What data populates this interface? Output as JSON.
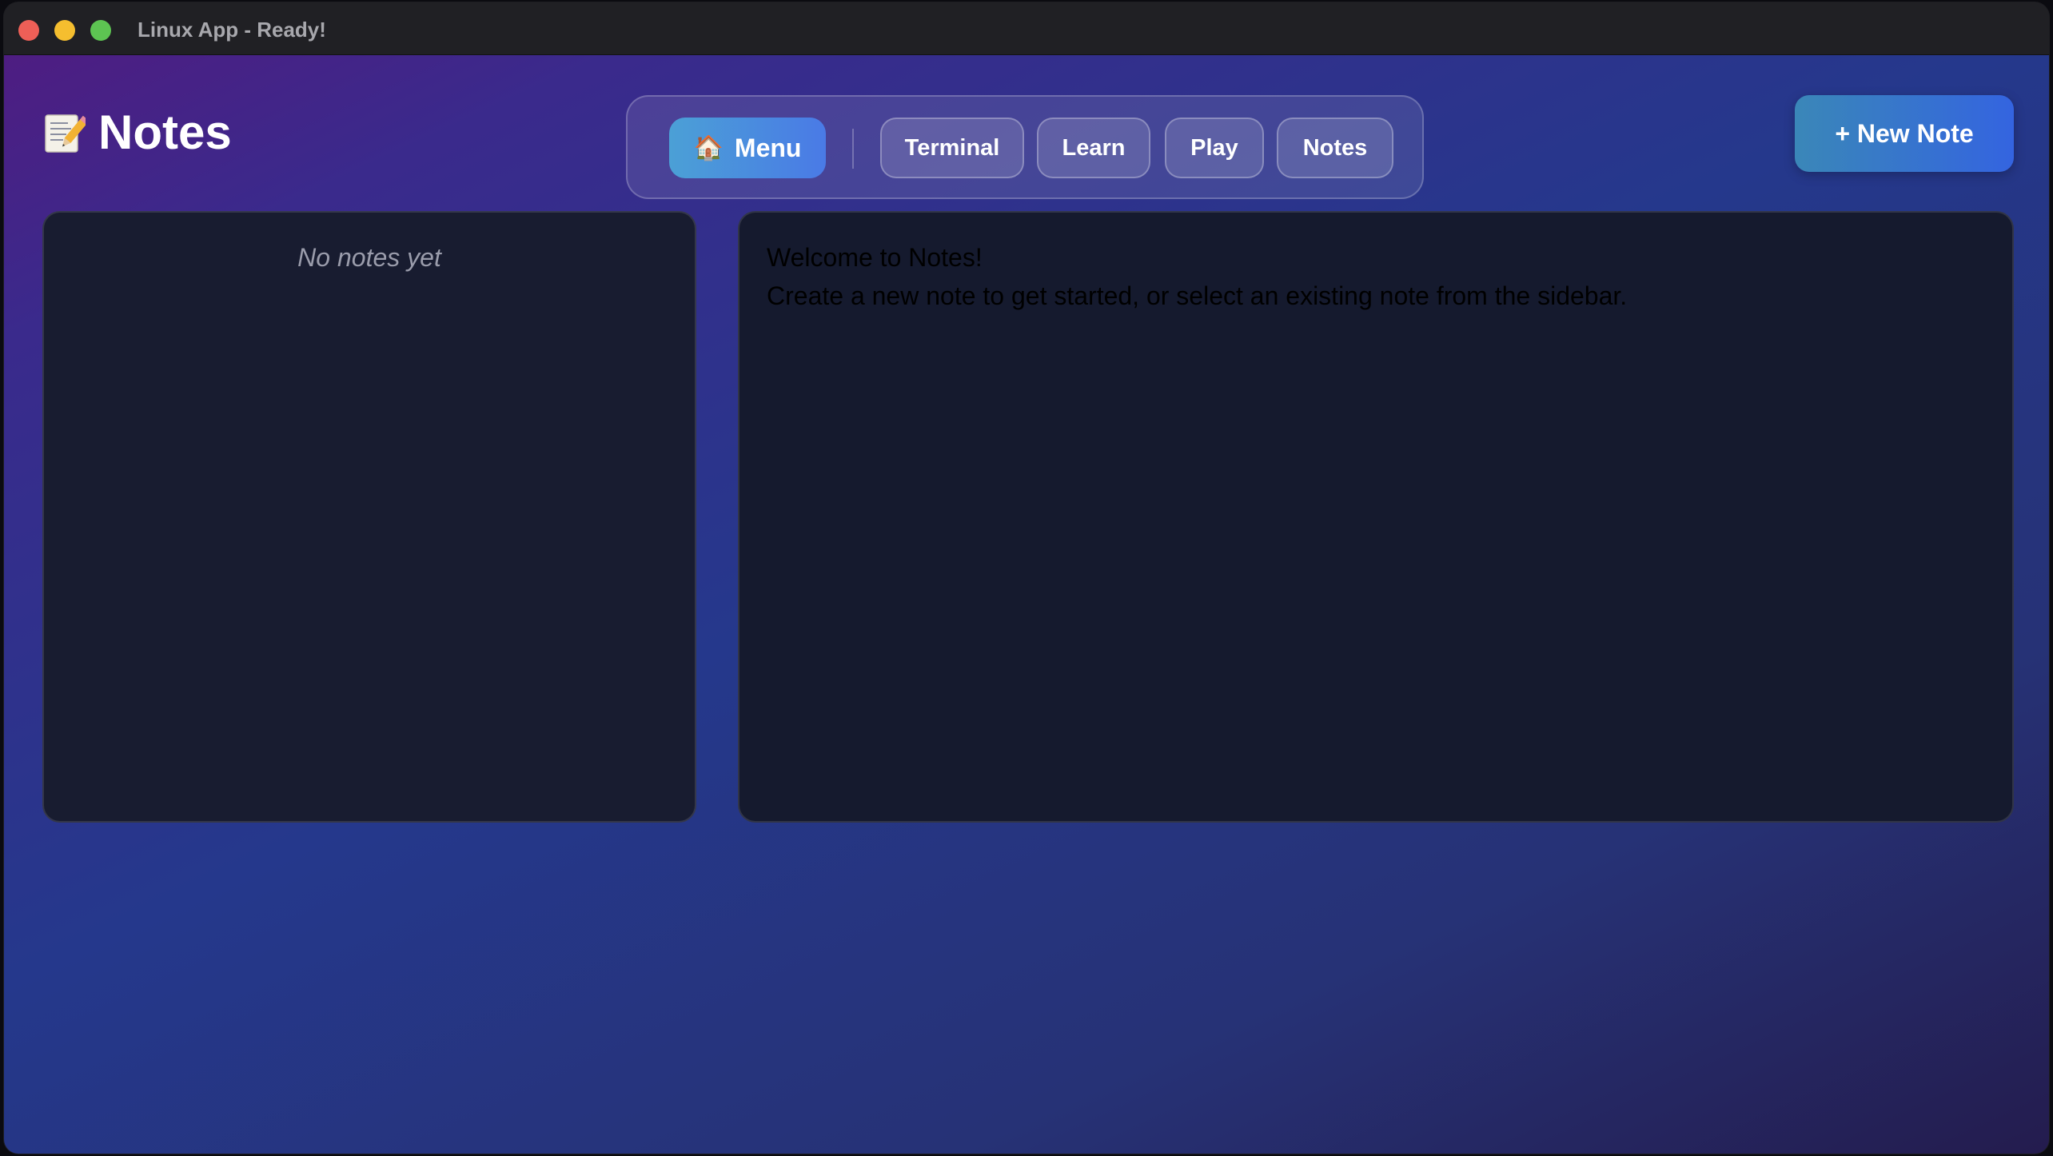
{
  "window": {
    "title": "Linux App - Ready!"
  },
  "header": {
    "app_icon": "memo-pencil-icon",
    "app_title": "Notes",
    "new_note_label": "+ New Note"
  },
  "nav": {
    "menu_icon": "house-icon",
    "menu_label": "Menu",
    "items": [
      {
        "label": "Terminal"
      },
      {
        "label": "Learn"
      },
      {
        "label": "Play"
      },
      {
        "label": "Notes"
      }
    ]
  },
  "sidebar": {
    "empty_text": "No notes yet"
  },
  "editor": {
    "welcome_title": "Welcome to Notes!",
    "welcome_body": "Create a new note to get started, or select an existing note from the sidebar."
  },
  "colors": {
    "accent_gradient_start": "#4ba0d6",
    "accent_gradient_end": "#4a7ae6",
    "background_gradient_start": "#4e1d82",
    "background_gradient_end": "#241c4e",
    "panel": "#181c30"
  }
}
